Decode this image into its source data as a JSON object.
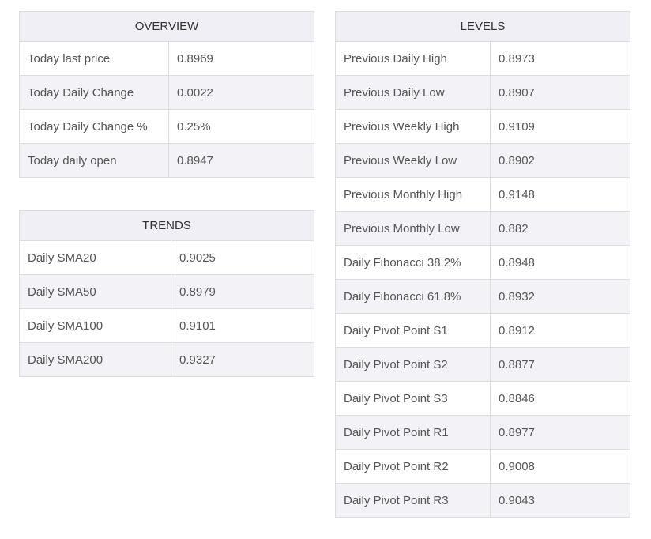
{
  "overview": {
    "title": "OVERVIEW",
    "rows": [
      {
        "label": "Today last price",
        "value": "0.8969"
      },
      {
        "label": "Today Daily Change",
        "value": "0.0022"
      },
      {
        "label": "Today Daily Change %",
        "value": "0.25%"
      },
      {
        "label": "Today daily open",
        "value": "0.8947"
      }
    ]
  },
  "trends": {
    "title": "TRENDS",
    "rows": [
      {
        "label": "Daily SMA20",
        "value": "0.9025"
      },
      {
        "label": "Daily SMA50",
        "value": "0.8979"
      },
      {
        "label": "Daily SMA100",
        "value": "0.9101"
      },
      {
        "label": "Daily SMA200",
        "value": "0.9327"
      }
    ]
  },
  "levels": {
    "title": "LEVELS",
    "rows": [
      {
        "label": "Previous Daily High",
        "value": "0.8973"
      },
      {
        "label": "Previous Daily Low",
        "value": "0.8907"
      },
      {
        "label": "Previous Weekly High",
        "value": "0.9109"
      },
      {
        "label": "Previous Weekly Low",
        "value": "0.8902"
      },
      {
        "label": "Previous Monthly High",
        "value": "0.9148"
      },
      {
        "label": "Previous Monthly Low",
        "value": "0.882"
      },
      {
        "label": "Daily Fibonacci 38.2%",
        "value": "0.8948"
      },
      {
        "label": "Daily Fibonacci 61.8%",
        "value": "0.8932"
      },
      {
        "label": "Daily Pivot Point S1",
        "value": "0.8912"
      },
      {
        "label": "Daily Pivot Point S2",
        "value": "0.8877"
      },
      {
        "label": "Daily Pivot Point S3",
        "value": "0.8846"
      },
      {
        "label": "Daily Pivot Point R1",
        "value": "0.8977"
      },
      {
        "label": "Daily Pivot Point R2",
        "value": "0.9008"
      },
      {
        "label": "Daily Pivot Point R3",
        "value": "0.9043"
      }
    ]
  },
  "colors": {
    "header_bg": "#efeff5",
    "stripe_bg": "#f2f2f7",
    "border": "#dcdcdc",
    "text": "#555555"
  }
}
